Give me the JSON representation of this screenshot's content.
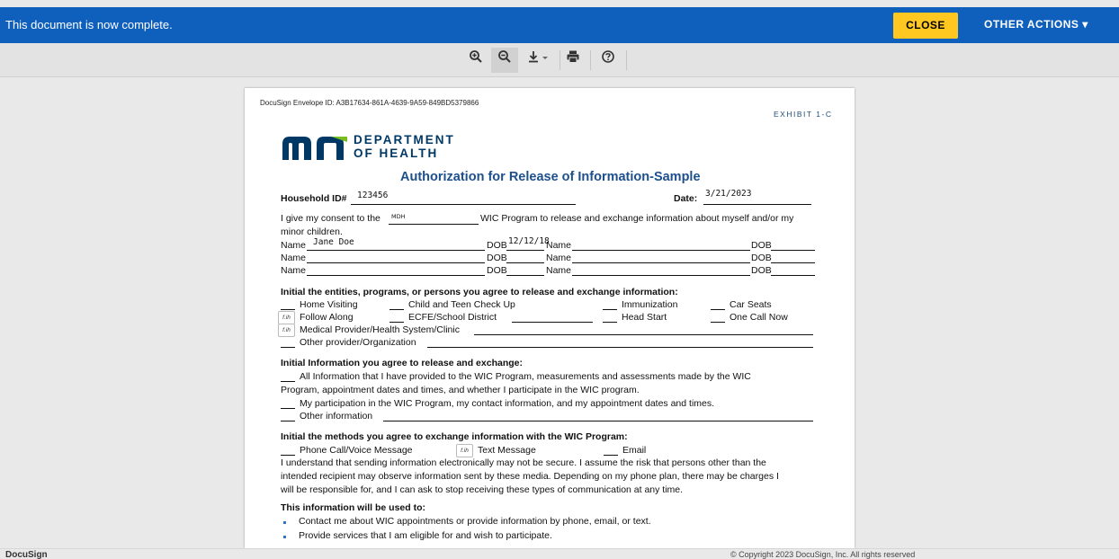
{
  "topbar": {
    "message": "This document is now complete.",
    "close_label": "CLOSE",
    "other_actions_label": "OTHER ACTIONS ▾"
  },
  "toolbar": {
    "buttons": [
      "zoom-in-icon",
      "zoom-out-icon",
      "download-icon",
      "print-icon",
      "help-icon"
    ]
  },
  "document": {
    "envelope_id": "DocuSign Envelope ID: A3B17634-861A-4639-9A59-849BD5379866",
    "exhibit": "EXHIBIT 1-C",
    "dept_line1": "DEPARTMENT",
    "dept_line2": "OF HEALTH",
    "title": "Authorization for Release of Information-Sample",
    "household_label": "Household ID#",
    "household_value": "123456",
    "date_label": "Date:",
    "date_value": "3/21/2023",
    "consent_pre": "I give my consent to the",
    "consent_value": "MDH",
    "consent_post": "WIC Program to release and exchange information about myself and/or my",
    "consent_line2": "minor children.",
    "name_label": "Name",
    "dob_label": "DOB",
    "name1_value": "Jane Doe",
    "dob1_value": "12/12/18",
    "entities_heading": "Initial the entities, programs, or persons you agree to release and exchange information:",
    "home_visiting": "Home Visiting",
    "child_teen": "Child and Teen Check Up",
    "immunization": "Immunization",
    "car_seats": "Car Seats",
    "follow_along": "Follow Along",
    "ecfe": "ECFE/School District",
    "head_start": "Head Start",
    "one_call_now": "One Call Now",
    "medical_provider": "Medical Provider/Health System/Clinic",
    "other_provider": "Other provider/Organization",
    "initial_mark": "f.ih",
    "info_heading": "Initial Information you agree to release and exchange:",
    "all_info_1": "All Information that I have provided to the WIC Program, measurements and assessments made by the WIC",
    "all_info_2": "Program, appointment dates and times, and whether I participate in the WIC program.",
    "participation": "My participation in the WIC Program, my contact information, and my appointment dates and times.",
    "other_info": "Other information",
    "methods_heading": "Initial the methods you agree to exchange information with the WIC Program:",
    "phone_call": "Phone Call/Voice Message",
    "text_message": "Text Message",
    "email": "Email",
    "understand_1": "I understand that sending information electronically may not be secure. I assume the risk that persons other than the",
    "understand_2": "intended recipient may observe information sent by these media. Depending on my phone plan, there may be charges I",
    "understand_3": "will be responsible for, and I can ask to stop receiving these types of communication at any time.",
    "used_heading": "This information will be used to:",
    "use_1": "Contact me about WIC appointments or provide information by phone, email, or text.",
    "use_2": "Provide services that I am eligible for and wish to participate."
  },
  "statusbar": {
    "brand": "DocuSign",
    "copyright": "© Copyright 2023 DocuSign, Inc. All rights reserved"
  },
  "colors": {
    "topbar": "#0f5fbd",
    "close_button": "#ffc820",
    "title_blue": "#1c4f8c",
    "mn_logo": "#003865"
  }
}
